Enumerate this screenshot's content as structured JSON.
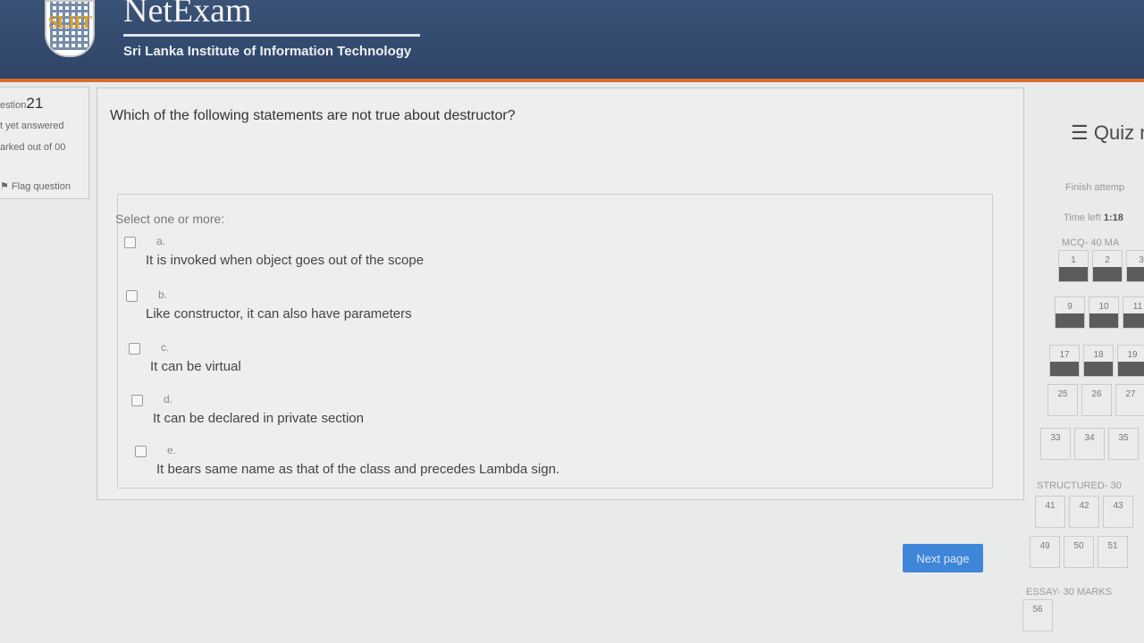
{
  "header": {
    "logo_text": "SLIIT",
    "app_name": "NetExam",
    "institute": "Sri Lanka Institute of Information Technology"
  },
  "question_info": {
    "label_prefix": "estion",
    "number": "21",
    "status": "t yet answered",
    "marks": "arked out of 00",
    "flag_label": "Flag question"
  },
  "question": {
    "text": "Which of the following statements are not true about destructor?",
    "prompt": "Select one or more:",
    "options": [
      {
        "letter": "a.",
        "text": "It is invoked when object goes out of the scope"
      },
      {
        "letter": "b.",
        "text": "Like constructor, it can also have parameters"
      },
      {
        "letter": "c.",
        "text": "It can be virtual"
      },
      {
        "letter": "d.",
        "text": "It can be declared in private section"
      },
      {
        "letter": "e.",
        "text": "It bears same name as that of the class and precedes Lambda sign."
      }
    ]
  },
  "next_button": "Next page",
  "quiz_nav": {
    "title": "Quiz n",
    "finish": "Finish attemp",
    "time_label": "Time left",
    "time_value": "1:18",
    "sections": [
      "MCQ- 40 MA",
      "STRUCTURED- 30",
      "ESSAY- 30 MARKS"
    ],
    "rows": [
      [
        "1",
        "2",
        "3"
      ],
      [
        "9",
        "10",
        "11"
      ],
      [
        "17",
        "18",
        "19"
      ],
      [
        "25",
        "26",
        "27"
      ],
      [
        "33",
        "34",
        "35"
      ],
      [
        "41",
        "42",
        "43"
      ],
      [
        "49",
        "50",
        "51"
      ],
      [
        "56"
      ]
    ]
  }
}
